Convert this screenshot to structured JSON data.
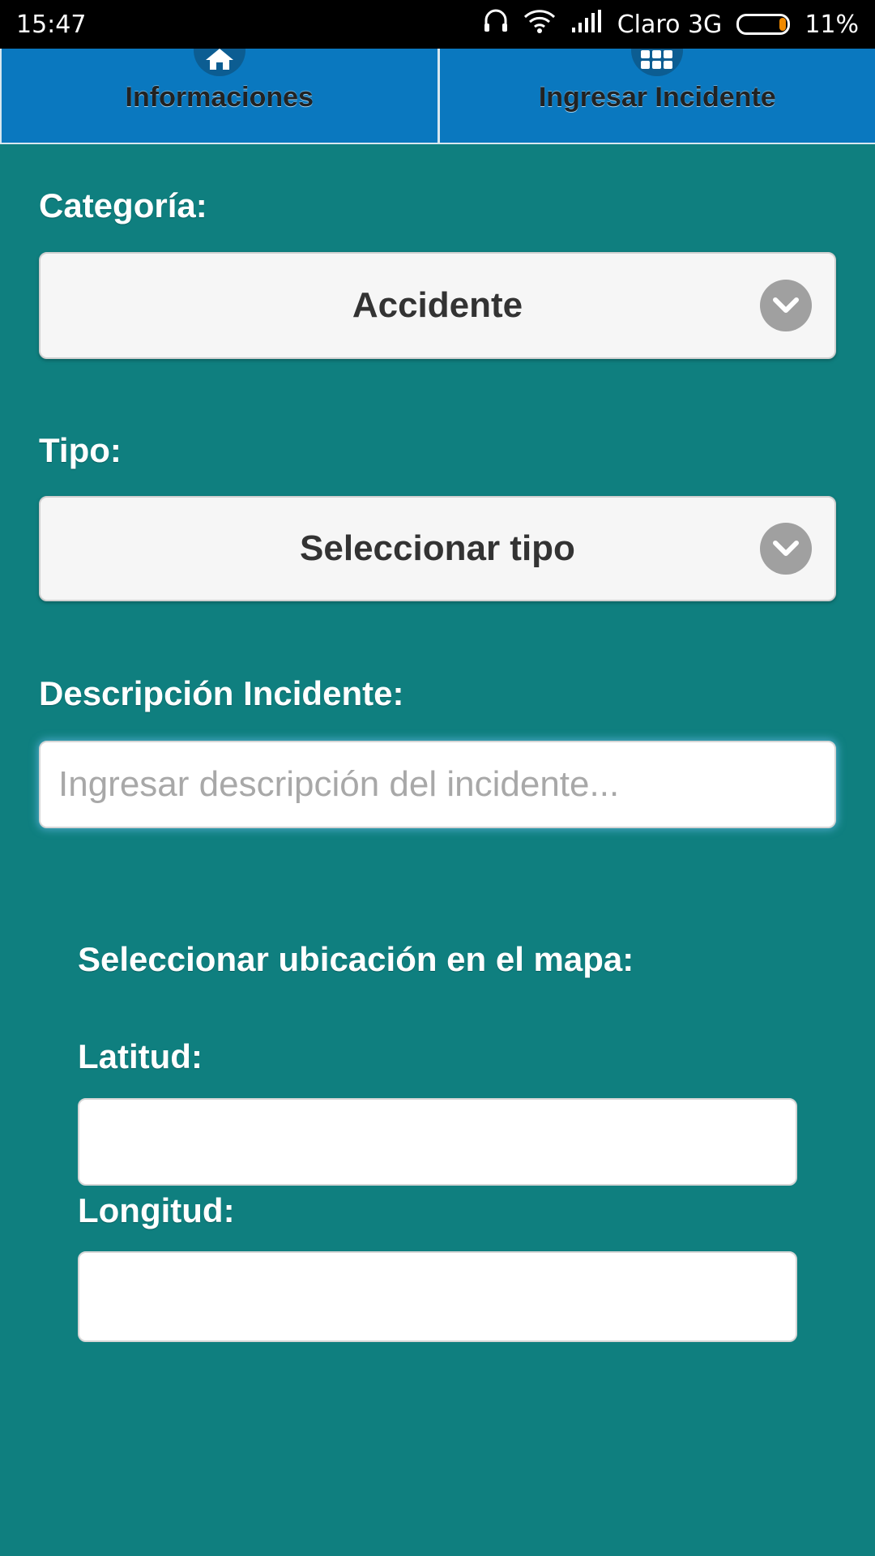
{
  "status_bar": {
    "time": "15:47",
    "carrier": "Claro 3G",
    "battery": "11%",
    "icons": [
      "headset-icon",
      "wifi-icon",
      "signal-icon",
      "battery-icon"
    ]
  },
  "tabs": [
    {
      "label": "Informaciones",
      "icon": "home-icon"
    },
    {
      "label": "Ingresar Incidente",
      "icon": "grid-icon"
    }
  ],
  "form": {
    "category_label": "Categoría:",
    "category_value": "Accidente",
    "type_label": "Tipo:",
    "type_value": "Seleccionar tipo",
    "description_label": "Descripción Incidente:",
    "description_placeholder": "Ingresar descripción del incidente...",
    "description_value": "",
    "map_heading": "Seleccionar ubicación en el mapa:",
    "latitude_label": "Latitud:",
    "latitude_value": "",
    "longitude_label": "Longitud:",
    "longitude_value": ""
  },
  "colors": {
    "background": "#0f7f7f",
    "tab_background": "#0a78bf",
    "status_bar": "#000000"
  }
}
